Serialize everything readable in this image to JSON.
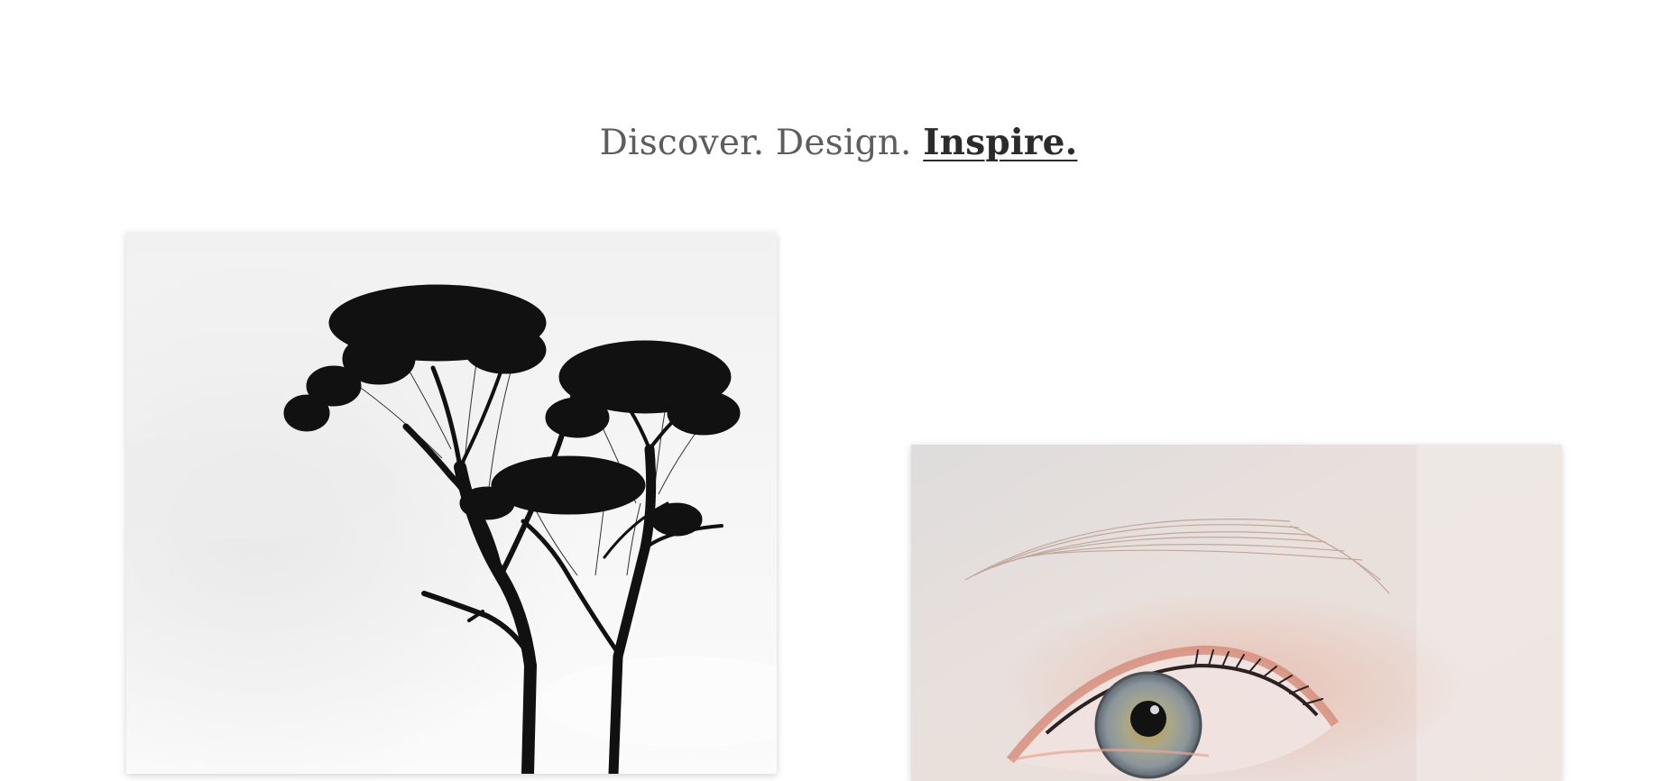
{
  "hero": {
    "headline_lead": "Discover. Design. ",
    "headline_accent": "Inspire."
  },
  "gallery": {
    "items": [
      {
        "subject": "tree-silhouette",
        "tone": "black-and-white"
      },
      {
        "subject": "eye-closeup",
        "tone": "pale-pink"
      }
    ]
  },
  "colors": {
    "background": "#ffffff",
    "headline_text": "#5d5d5d",
    "headline_accent": "#2b2b2b"
  }
}
